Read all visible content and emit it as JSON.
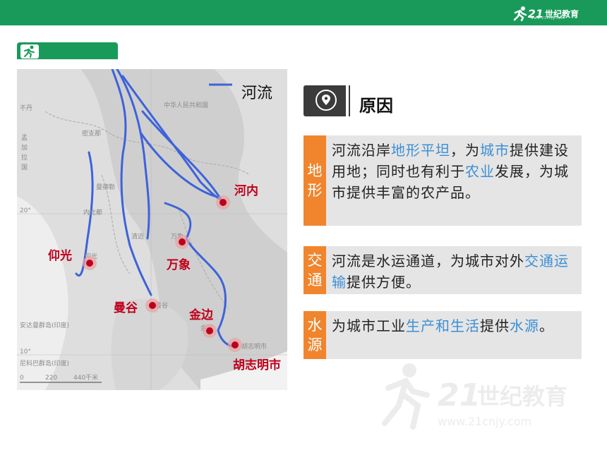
{
  "header": {
    "logo_number": "21",
    "logo_text": "世纪教育",
    "logo_url": "www.21cnjy.com"
  },
  "map": {
    "legend": {
      "label": "河流"
    },
    "background_labels": [
      "中华人民共和国",
      "不丹",
      "密支那",
      "曼德勒",
      "内比都",
      "清迈",
      "万象",
      "仰光",
      "曼谷",
      "金边",
      "胡志明市",
      "安达曼群岛(印度)",
      "尼科巴群岛(印度)",
      "孟",
      "加",
      "拉",
      "国",
      "20°",
      "10°",
      "0",
      "220",
      "440千米"
    ],
    "cities": [
      {
        "name": "河内"
      },
      {
        "name": "仰光"
      },
      {
        "name": "万象"
      },
      {
        "name": "曼谷"
      },
      {
        "name": "金边"
      },
      {
        "name": "胡志明市"
      }
    ],
    "colors": {
      "river": "#3d63d9",
      "city": "#c0001b"
    }
  },
  "reasons": {
    "title": "原因",
    "blocks": [
      {
        "tag": [
          "地",
          "形"
        ],
        "segments": [
          {
            "t": "河流沿岸",
            "h": false
          },
          {
            "t": "地形平坦",
            "h": true
          },
          {
            "t": "，为",
            "h": false
          },
          {
            "t": "城市",
            "h": true
          },
          {
            "t": "提供建设用地；同时也有利于",
            "h": false
          },
          {
            "t": "农业",
            "h": true
          },
          {
            "t": "发展，为城市提供丰富的农产品。",
            "h": false
          }
        ]
      },
      {
        "tag": [
          "交",
          "通"
        ],
        "segments": [
          {
            "t": "河流是水运通道，为城市对外",
            "h": false
          },
          {
            "t": "交通运输",
            "h": true
          },
          {
            "t": "提供方便。",
            "h": false
          }
        ]
      },
      {
        "tag": [
          "水",
          "源"
        ],
        "segments": [
          {
            "t": "为城市工业",
            "h": false
          },
          {
            "t": "生产和生活",
            "h": true
          },
          {
            "t": "提供",
            "h": false
          },
          {
            "t": "水源",
            "h": true
          },
          {
            "t": "。",
            "h": false
          }
        ]
      }
    ]
  },
  "colors": {
    "green": "#1a9a5a",
    "orange": "#f0852d",
    "highlight": "#3c8fd6"
  }
}
